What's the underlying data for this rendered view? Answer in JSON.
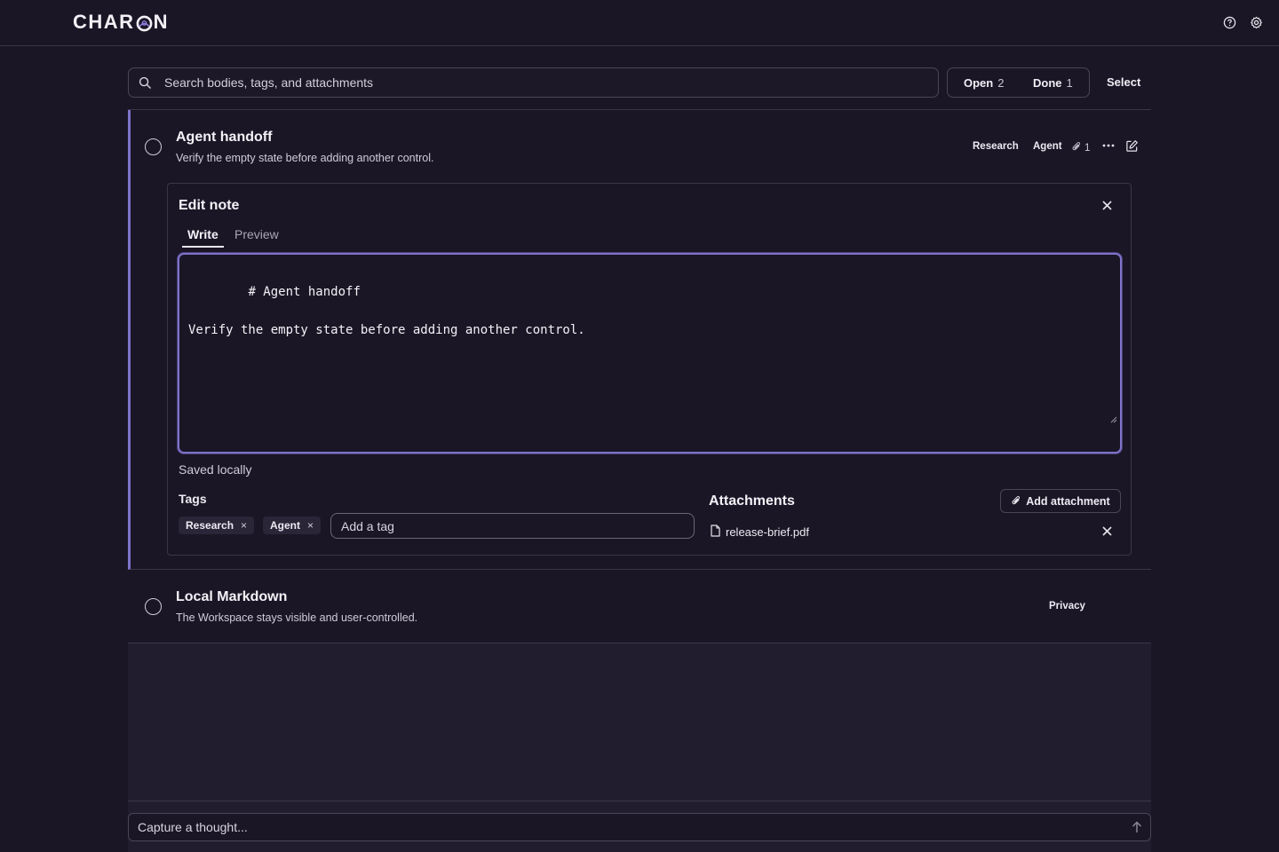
{
  "app": {
    "logo_prefix": "CHAR",
    "logo_suffix": "N",
    "accent_color": "#7e73c9"
  },
  "topbar": {
    "icons": [
      "help-icon",
      "gear-icon"
    ]
  },
  "search": {
    "placeholder": "Search bodies, tags, and attachments"
  },
  "filters": {
    "open_label": "Open",
    "open_count": "2",
    "done_label": "Done",
    "done_count": "1",
    "select_label": "Select"
  },
  "notes": [
    {
      "title": "Agent handoff",
      "subtitle": "Verify the empty state before adding another control.",
      "tags": [
        "Research",
        "Agent"
      ],
      "attachment_count": "1"
    },
    {
      "title": "Local Markdown",
      "subtitle": "The Workspace stays visible and user-controlled.",
      "tags": [
        "Privacy"
      ]
    }
  ],
  "editor": {
    "title": "Edit note",
    "tab_write": "Write",
    "tab_preview": "Preview",
    "body": "# Agent handoff\n\nVerify the empty state before adding another control.",
    "status": "Saved locally",
    "tags_label": "Tags",
    "tags": [
      "Research",
      "Agent"
    ],
    "tag_placeholder": "Add a tag",
    "attachments_label": "Attachments",
    "add_attachment_label": "Add attachment",
    "attachments": [
      "release-brief.pdf"
    ]
  },
  "composer": {
    "placeholder": "Capture a thought..."
  }
}
